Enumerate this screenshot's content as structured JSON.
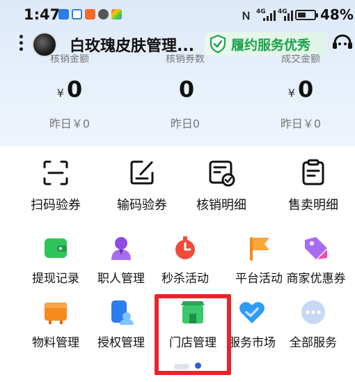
{
  "status_bar": {
    "time": "1:47",
    "network1": "4G",
    "network2": "4G",
    "battery": "48%"
  },
  "header": {
    "store_name": "白玫瑰皮肤管理...",
    "badge": "履约服务优秀"
  },
  "stats": [
    {
      "label": "核销金额",
      "currency": "¥",
      "value": "0",
      "yesterday": "昨日￥0"
    },
    {
      "label": "核销券数",
      "currency": "",
      "value": "0",
      "yesterday": "昨日0"
    },
    {
      "label": "成交金额",
      "currency": "¥",
      "value": "0",
      "yesterday": "昨日￥0"
    }
  ],
  "tools": [
    {
      "label": "扫码验券",
      "icon": "scan-icon"
    },
    {
      "label": "输码验券",
      "icon": "edit-code-icon"
    },
    {
      "label": "核销明细",
      "icon": "verify-detail-icon"
    },
    {
      "label": "售卖明细",
      "icon": "sales-detail-icon"
    }
  ],
  "services_row1": [
    {
      "label": "提现记录",
      "icon": "wallet-icon"
    },
    {
      "label": "职人管理",
      "icon": "staff-icon"
    },
    {
      "label": "秒杀活动",
      "icon": "flash-sale-icon"
    },
    {
      "label": "平台活动",
      "icon": "flag-icon"
    },
    {
      "label": "商家优惠券",
      "icon": "coupon-icon"
    }
  ],
  "services_row2": [
    {
      "label": "物料管理",
      "icon": "material-icon"
    },
    {
      "label": "授权管理",
      "icon": "authorize-icon"
    },
    {
      "label": "门店管理",
      "icon": "store-icon"
    },
    {
      "label": "服务市场",
      "icon": "market-icon"
    },
    {
      "label": "全部服务",
      "icon": "more-icon"
    }
  ],
  "colors": {
    "highlight": "#e8242a",
    "badge_text": "#1aa34a"
  }
}
